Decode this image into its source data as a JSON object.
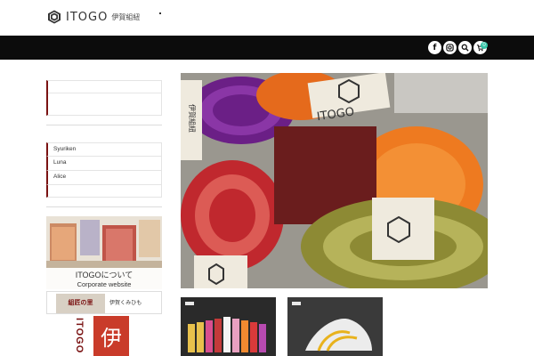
{
  "header": {
    "logo_text": "ITOGO",
    "logo_sub": "伊賀組紐"
  },
  "navbar": {
    "icons": [
      "facebook-icon",
      "instagram-icon",
      "search-icon",
      "cart-icon"
    ],
    "cart_count": "0"
  },
  "sidebar": {
    "menu_items": [
      "Syuriken",
      "Luna",
      "Alice"
    ],
    "corporate_banner": {
      "title": "ITOGOについて",
      "subtitle": "Corporate website"
    },
    "kumihimo_banner": {
      "left_text": "組匠の里",
      "right_text": "伊賀くみひも"
    },
    "iga_banner": {
      "vertical_text": "ITOGO",
      "seal_text": "伊"
    }
  },
  "hero": {
    "label": "ITOGO",
    "label_sub": "伊賀組紐"
  },
  "colors": {
    "navbar": "#0c0c0c",
    "accent": "#7a1212",
    "cart_badge": "#35c5a8"
  }
}
